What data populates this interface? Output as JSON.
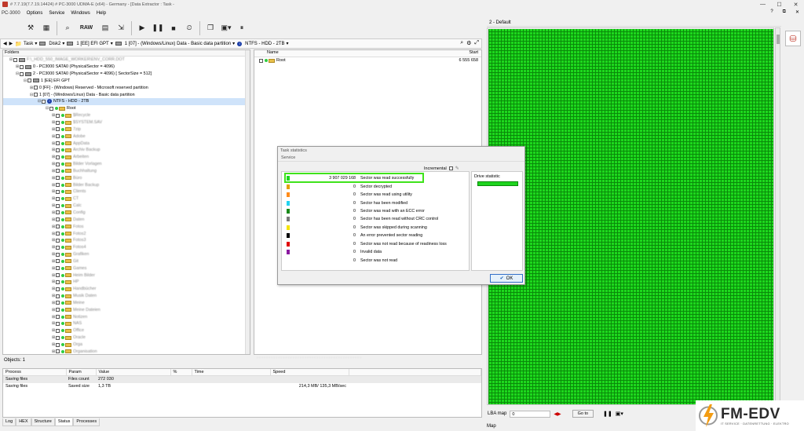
{
  "titlebar": {
    "title": "# 7.7.19(7.7.19.14424) # PC-3000 UDMA-E (x64) - Germany - [Data Extractor : Task - ",
    "min": "—",
    "max": "☐",
    "close": "✕"
  },
  "menu": {
    "app": "PC-3000",
    "items": [
      "Options",
      "Service",
      "Windows",
      "Help"
    ],
    "right_icons": [
      "?",
      "⧉",
      "✕"
    ]
  },
  "toolbar": {
    "raw_label": "RAW"
  },
  "pathbar": {
    "task": "Task",
    "disk": "Disk2",
    "partition1": "1 [EE] EFI GPT",
    "partition2": "1 [07] - (Windows/Linux) Data - Basic data partition",
    "volume": "NTFS - HDD - 2TB"
  },
  "folders": {
    "header": "Folders",
    "rows": [
      {
        "indent": 8,
        "text": "F:\\_HDD_550_IMAGE_WORKER\\ENV_CORR.DOT",
        "icon": "disk",
        "blur": true,
        "toggle": "⊟"
      },
      {
        "indent": 16,
        "text": "0 - PC3000 SATA0 (PhysicalSector = 4096)",
        "icon": "disk",
        "toggle": "⊞"
      },
      {
        "indent": 16,
        "text": "2 - PC3000 SATA0 (PhysicalSector = 4096) [ SectorSize = 512]",
        "icon": "disk",
        "toggle": "⊟"
      },
      {
        "indent": 26,
        "text": "1 [EE] EFI GPT",
        "icon": "disk",
        "toggle": "⊟"
      },
      {
        "indent": 34,
        "text": "0 [FF] - (Windows) Reserved - Microsoft reserved partition",
        "icon": "none",
        "toggle": "⊞"
      },
      {
        "indent": 34,
        "text": "1 [07] - (Windows/Linux) Data - Basic data partition",
        "icon": "none",
        "toggle": "⊟"
      },
      {
        "indent": 44,
        "text": "NTFS - HDD - 2TB",
        "icon": "info",
        "toggle": "⊟",
        "selected": true
      },
      {
        "indent": 54,
        "text": "Root",
        "icon": "folder",
        "toggle": "⊟"
      },
      {
        "indent": 62,
        "text": "$Recycle",
        "icon": "folder",
        "toggle": "⊞",
        "blur": true
      },
      {
        "indent": 62,
        "text": "$SYSTEM.SAV",
        "icon": "folder",
        "toggle": "⊞",
        "blur": true
      },
      {
        "indent": 62,
        "text": "7zip",
        "icon": "folder",
        "toggle": "⊞",
        "blur": true
      },
      {
        "indent": 62,
        "text": "Adobe",
        "icon": "folder",
        "toggle": "⊞",
        "blur": true
      },
      {
        "indent": 62,
        "text": "AppData",
        "icon": "folder",
        "toggle": "⊞",
        "blur": true
      },
      {
        "indent": 62,
        "text": "Archiv Backup",
        "icon": "folder",
        "toggle": "⊞",
        "blur": true
      },
      {
        "indent": 62,
        "text": "Arbeiten",
        "icon": "folder",
        "toggle": "⊞",
        "blur": true
      },
      {
        "indent": 62,
        "text": "Bilder Vorlagen",
        "icon": "folder",
        "toggle": "⊞",
        "blur": true
      },
      {
        "indent": 62,
        "text": "Buchhaltung",
        "icon": "folder",
        "toggle": "⊞",
        "blur": true
      },
      {
        "indent": 62,
        "text": "Büro",
        "icon": "folder",
        "toggle": "⊞",
        "blur": true
      },
      {
        "indent": 62,
        "text": "Bilder Backup",
        "icon": "folder",
        "toggle": "⊞",
        "blur": true
      },
      {
        "indent": 62,
        "text": "Clients",
        "icon": "folder",
        "toggle": "⊞",
        "blur": true
      },
      {
        "indent": 62,
        "text": "CT",
        "icon": "folder",
        "toggle": "⊞",
        "blur": true
      },
      {
        "indent": 62,
        "text": "Calc",
        "icon": "folder",
        "toggle": "⊞",
        "blur": true
      },
      {
        "indent": 62,
        "text": "Config",
        "icon": "folder",
        "toggle": "⊞",
        "blur": true
      },
      {
        "indent": 62,
        "text": "Daten",
        "icon": "folder",
        "toggle": "⊞",
        "blur": true
      },
      {
        "indent": 62,
        "text": "Fotos",
        "icon": "folder",
        "toggle": "⊞",
        "blur": true
      },
      {
        "indent": 62,
        "text": "Fotos2",
        "icon": "folder",
        "toggle": "⊞",
        "blur": true
      },
      {
        "indent": 62,
        "text": "Fotos3",
        "icon": "folder",
        "toggle": "⊞",
        "blur": true
      },
      {
        "indent": 62,
        "text": "Fotos4",
        "icon": "folder",
        "toggle": "⊞",
        "blur": true
      },
      {
        "indent": 62,
        "text": "Grafiken",
        "icon": "folder",
        "toggle": "⊞",
        "blur": true
      },
      {
        "indent": 62,
        "text": "Git",
        "icon": "folder",
        "toggle": "⊞",
        "blur": true
      },
      {
        "indent": 62,
        "text": "Games",
        "icon": "folder",
        "toggle": "⊞",
        "blur": true
      },
      {
        "indent": 62,
        "text": "Heim Bilder",
        "icon": "folder",
        "toggle": "⊞",
        "blur": true
      },
      {
        "indent": 62,
        "text": "HP",
        "icon": "folder",
        "toggle": "⊞",
        "blur": true
      },
      {
        "indent": 62,
        "text": "Handbücher",
        "icon": "folder",
        "toggle": "⊞",
        "blur": true
      },
      {
        "indent": 62,
        "text": "Musik Daten",
        "icon": "folder",
        "toggle": "⊞",
        "blur": true
      },
      {
        "indent": 62,
        "text": "Meine",
        "icon": "folder",
        "toggle": "⊞",
        "blur": true
      },
      {
        "indent": 62,
        "text": "Meine Dateien",
        "icon": "folder",
        "toggle": "⊞",
        "blur": true
      },
      {
        "indent": 62,
        "text": "Notizen",
        "icon": "folder",
        "toggle": "⊞",
        "blur": true
      },
      {
        "indent": 62,
        "text": "NAS",
        "icon": "folder",
        "toggle": "⊞",
        "blur": true
      },
      {
        "indent": 62,
        "text": "Office",
        "icon": "folder",
        "toggle": "⊞",
        "blur": true
      },
      {
        "indent": 62,
        "text": "Oracle",
        "icon": "folder",
        "toggle": "⊞",
        "blur": true
      },
      {
        "indent": 62,
        "text": "Orga",
        "icon": "folder",
        "toggle": "⊞",
        "blur": true
      },
      {
        "indent": 62,
        "text": "Organisation",
        "icon": "folder",
        "toggle": "⊞",
        "blur": true
      },
      {
        "indent": 62,
        "text": "Privat",
        "icon": "folder",
        "toggle": "⊞",
        "blur": true
      }
    ]
  },
  "filelist": {
    "col_name": "Name",
    "col_start": "Start",
    "rows": [
      {
        "name": "Root",
        "start": "6 555 658"
      }
    ]
  },
  "objects_label": "Objects: 1",
  "processes": {
    "headers": [
      "Process",
      "Param",
      "Value",
      "%",
      "Time",
      "Speed",
      "",
      "",
      "",
      "",
      ""
    ],
    "rows": [
      {
        "process": "Saving files",
        "param": "Files count",
        "value": "272 030",
        "pct": "",
        "time": "",
        "speed": ""
      },
      {
        "process": "Saving files",
        "param": "Saved size",
        "value": "1,3 TB",
        "pct": "",
        "time": "",
        "speed": "214,3 MB/ 135,3 MB/sec"
      }
    ]
  },
  "bottom_tabs": [
    "Log",
    "HEX",
    "Structure",
    "Status",
    "Processes"
  ],
  "right_panel": {
    "title": "2 - Default",
    "lba_label": "LBA map",
    "lba_value": "0",
    "goto": "Go to",
    "map_label": "Map",
    "grid_color": "#1dd81d"
  },
  "dialog": {
    "title": "Task statistics",
    "service": "Service",
    "incremental": "Incremental",
    "drive_stat": "Drive statistic",
    "ok": "OK",
    "rows": [
      {
        "color": "#1dd81d",
        "value": "3 907 029 168",
        "label": "Sector was read successfully"
      },
      {
        "color": "#e2a000",
        "value": "0",
        "label": "Sector decrypted"
      },
      {
        "color": "#ff8c1a",
        "value": "0",
        "label": "Sector was read using utility"
      },
      {
        "color": "#22d3f0",
        "value": "0",
        "label": "Sector has been modified"
      },
      {
        "color": "#1a8a1a",
        "value": "0",
        "label": "Sector was read with an ECC error"
      },
      {
        "color": "#7a7a7a",
        "value": "0",
        "label": "Sector has been read without CRC control"
      },
      {
        "color": "#f5e400",
        "value": "0",
        "label": "Sector was skipped during scanning"
      },
      {
        "color": "#000000",
        "value": "0",
        "label": "An error prevented sector reading"
      },
      {
        "color": "#e00000",
        "value": "0",
        "label": "Sector was not read because of readiness loss"
      },
      {
        "color": "#8a1aa0",
        "value": "0",
        "label": "Invalid data"
      },
      {
        "color": "#ffffff",
        "value": "0",
        "label": "Sector was not read"
      }
    ]
  },
  "logo": {
    "main": "FM-EDV",
    "sub": "IT SERVICE · DATENRETTUNG · ELEKTRO"
  }
}
